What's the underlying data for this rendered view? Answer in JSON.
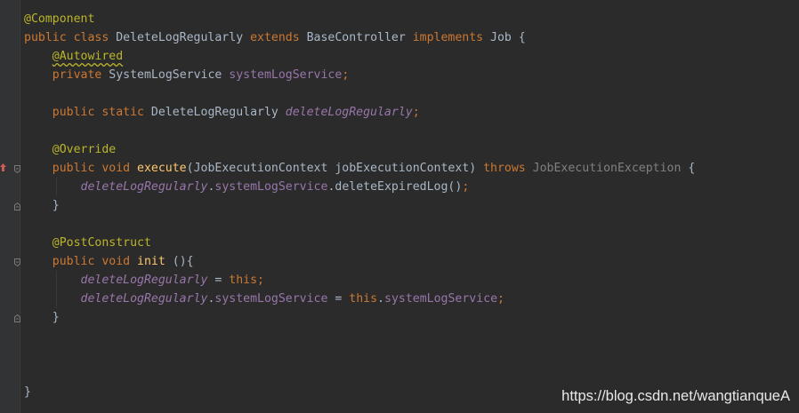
{
  "code": {
    "l1": "@Component",
    "l2": {
      "kw1": "public class ",
      "name": "DeleteLogRegularly ",
      "kw2": "extends ",
      "base": "BaseController ",
      "kw3": "implements ",
      "iface": "Job {"
    },
    "l3": "@Autowired",
    "l4": {
      "kw": "private ",
      "type": "SystemLogService ",
      "field": "systemLogService",
      "semi": ";"
    },
    "l6": {
      "kw": "public static ",
      "type": "DeleteLogRegularly ",
      "field": "deleteLogRegularly",
      "semi": ";"
    },
    "l8": "@Override",
    "l9": {
      "kw": "public void ",
      "method": "execute",
      "params": "(JobExecutionContext jobExecutionContext) ",
      "throws": "throws ",
      "exc": "JobExecutionException",
      "brace": " {"
    },
    "l10": {
      "sfield": "deleteLogRegularly",
      "dot1": ".",
      "field": "systemLogService",
      "call": ".deleteExpiredLog()",
      "semi": ";"
    },
    "l11": "}",
    "l13": "@PostConstruct",
    "l14": {
      "kw": "public void ",
      "method": "init",
      "rest": " (){"
    },
    "l15": {
      "sfield": "deleteLogRegularly",
      "eq": " = ",
      "kw": "this",
      "semi": ";"
    },
    "l16": {
      "sfield": "deleteLogRegularly",
      "dot1": ".",
      "field": "systemLogService",
      "eq": " = ",
      "kw": "this",
      "dot2": ".",
      "field2": "systemLogService",
      "semi": ";"
    },
    "l17": "}",
    "l21": "}"
  },
  "watermark": "https://blog.csdn.net/wangtianqueA",
  "colors": {
    "background": "#2b2b2b",
    "keyword": "#cc7832",
    "annotation": "#bbb529",
    "field": "#9876aa",
    "method": "#ffc66d",
    "text": "#a9b7c6"
  }
}
